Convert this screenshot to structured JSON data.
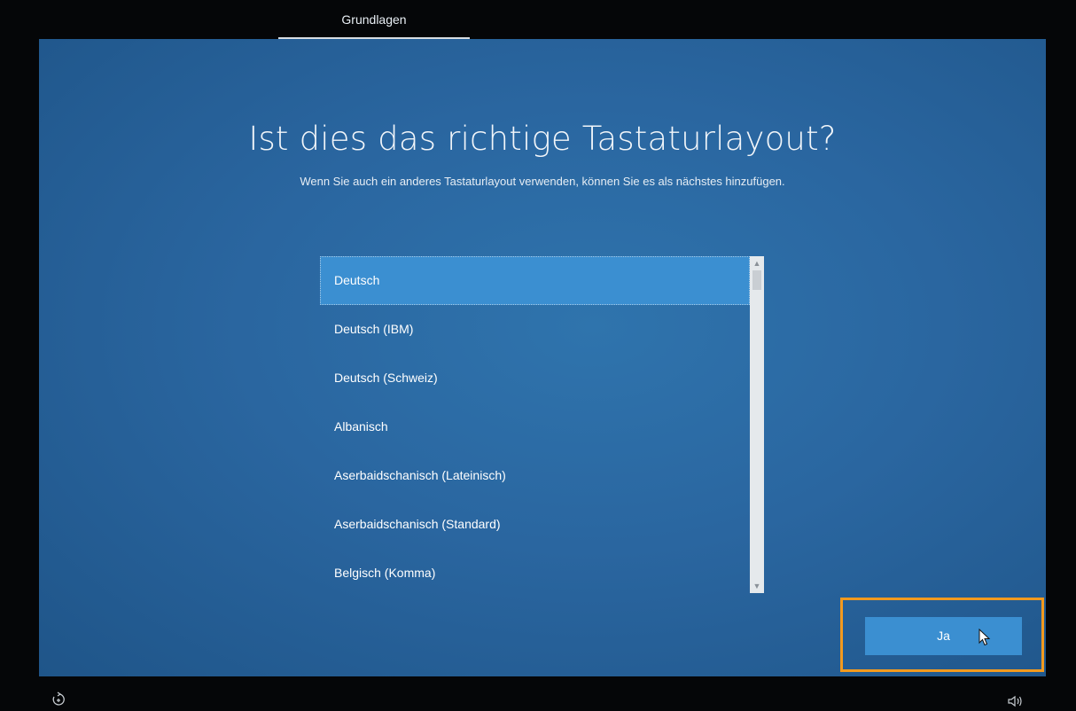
{
  "top_tabs": [
    {
      "label": "Grundlagen",
      "active": true
    }
  ],
  "page": {
    "title": "Ist dies das richtige Tastaturlayout?",
    "subtitle": "Wenn Sie auch ein anderes Tastaturlayout verwenden, können Sie es als nächstes hinzufügen."
  },
  "keyboard_layouts": {
    "selected": "Deutsch",
    "items": [
      "Deutsch",
      "Deutsch (IBM)",
      "Deutsch (Schweiz)",
      "Albanisch",
      "Aserbaidschanisch (Lateinisch)",
      "Aserbaidschanisch (Standard)",
      "Belgisch (Komma)"
    ]
  },
  "buttons": {
    "confirm_label": "Ja"
  },
  "icons": {
    "accessibility": "accessibility-icon",
    "volume": "volume-icon",
    "cursor": "mouse-pointer-icon",
    "scroll_up": "chevron-up-icon",
    "scroll_down": "chevron-down-icon"
  },
  "colors": {
    "background": "#2a66a0",
    "selection": "#3b8fd1",
    "button": "#3b8fd1",
    "highlight_frame": "#f39a1e"
  }
}
